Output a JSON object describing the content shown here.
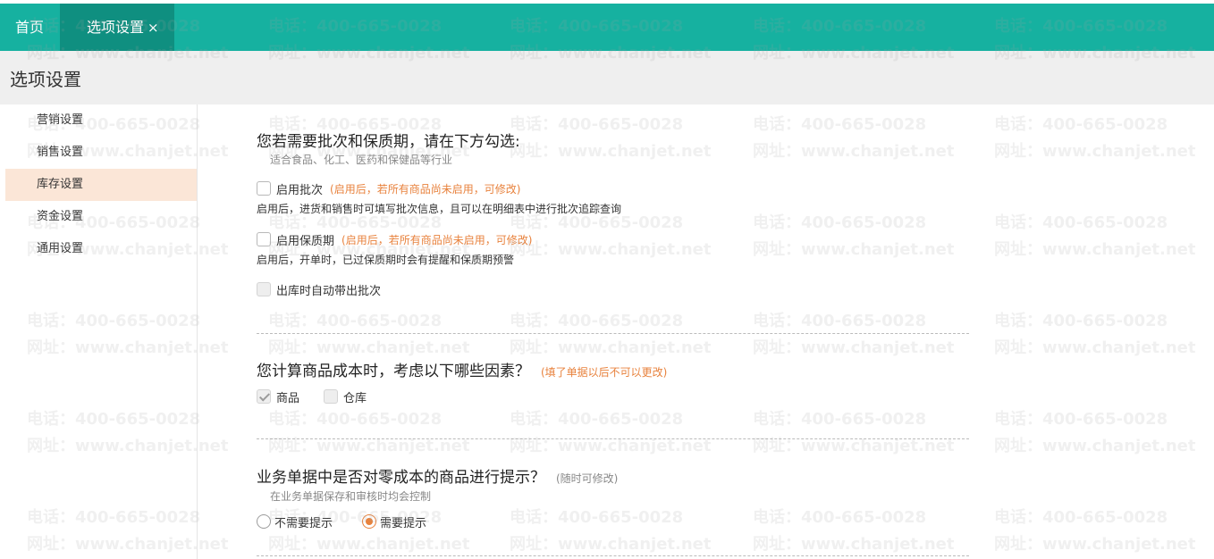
{
  "tabs": {
    "home_label": "首页",
    "active_label": "选项设置",
    "close_glyph": "×"
  },
  "page": {
    "title": "选项设置"
  },
  "sidebar": {
    "items": [
      {
        "label": "营销设置"
      },
      {
        "label": "销售设置"
      },
      {
        "label": "库存设置"
      },
      {
        "label": "资金设置"
      },
      {
        "label": "通用设置"
      }
    ],
    "active_index": 2
  },
  "batch_section": {
    "title": "您若需要批次和保质期，请在下方勾选:",
    "subtitle": "适合食品、化工、医药和保健品等行业",
    "enable_batch": {
      "label": "启用批次",
      "hint": "(启用后，若所有商品尚未启用，可修改)",
      "desc": "启用后，进货和销售时可填写批次信息，且可以在明细表中进行批次追踪查询",
      "checked": false
    },
    "enable_shelf_life": {
      "label": "启用保质期",
      "hint": "(启用后，若所有商品尚未启用，可修改)",
      "desc": "启用后，开单时，已过保质期时会有提醒和保质期预警",
      "checked": false
    },
    "auto_batch": {
      "label": "出库时自动带出批次",
      "checked": false,
      "disabled": true
    }
  },
  "cost_section": {
    "title": "您计算商品成本时，考虑以下哪些因素？",
    "note": "(填了单据以后不可以更改)",
    "options": [
      {
        "label": "商品",
        "checked": true,
        "disabled": true
      },
      {
        "label": "仓库",
        "checked": false,
        "disabled": true
      }
    ]
  },
  "zero_cost_section": {
    "title": "业务单据中是否对零成本的商品进行提示？",
    "note": "(随时可修改)",
    "subtitle": "在业务单据保存和审核时均会控制",
    "options": [
      {
        "label": "不需要提示",
        "selected": false
      },
      {
        "label": "需要提示",
        "selected": true
      }
    ]
  },
  "watermark": {
    "phone": "电话：400-665-0028",
    "site": "网址：www.chanjet.net"
  },
  "colors": {
    "header": "#16b1a0",
    "header_active_tab": "#0f8f80",
    "accent_orange": "#e8823d",
    "sidebar_active": "#fbe6d7"
  }
}
